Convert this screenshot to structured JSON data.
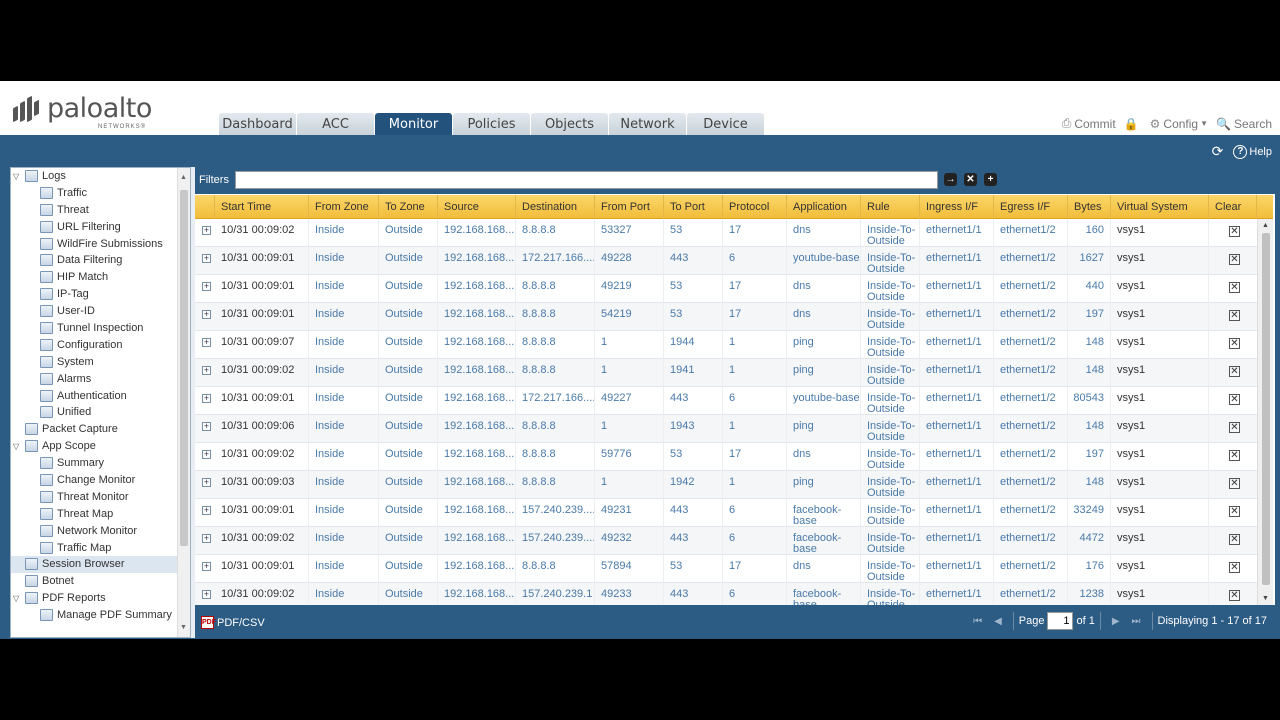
{
  "brand": {
    "name": "paloalto",
    "sub": "NETWORKS®"
  },
  "tabs": [
    "Dashboard",
    "ACC",
    "Monitor",
    "Policies",
    "Objects",
    "Network",
    "Device"
  ],
  "active_tab": "Monitor",
  "top_actions": {
    "commit": "Commit",
    "config": "Config",
    "search": "Search"
  },
  "help_label": "Help",
  "sidebar": [
    {
      "label": "Logs",
      "level": 0,
      "toggle": "▽"
    },
    {
      "label": "Traffic",
      "level": 1
    },
    {
      "label": "Threat",
      "level": 1
    },
    {
      "label": "URL Filtering",
      "level": 1
    },
    {
      "label": "WildFire Submissions",
      "level": 1
    },
    {
      "label": "Data Filtering",
      "level": 1
    },
    {
      "label": "HIP Match",
      "level": 1
    },
    {
      "label": "IP-Tag",
      "level": 1
    },
    {
      "label": "User-ID",
      "level": 1
    },
    {
      "label": "Tunnel Inspection",
      "level": 1
    },
    {
      "label": "Configuration",
      "level": 1
    },
    {
      "label": "System",
      "level": 1
    },
    {
      "label": "Alarms",
      "level": 1
    },
    {
      "label": "Authentication",
      "level": 1
    },
    {
      "label": "Unified",
      "level": 1
    },
    {
      "label": "Packet Capture",
      "level": 0
    },
    {
      "label": "App Scope",
      "level": 0,
      "toggle": "▽"
    },
    {
      "label": "Summary",
      "level": 1
    },
    {
      "label": "Change Monitor",
      "level": 1
    },
    {
      "label": "Threat Monitor",
      "level": 1
    },
    {
      "label": "Threat Map",
      "level": 1
    },
    {
      "label": "Network Monitor",
      "level": 1
    },
    {
      "label": "Traffic Map",
      "level": 1
    },
    {
      "label": "Session Browser",
      "level": 0,
      "selected": true
    },
    {
      "label": "Botnet",
      "level": 0
    },
    {
      "label": "PDF Reports",
      "level": 0,
      "toggle": "▽"
    },
    {
      "label": "Manage PDF Summary",
      "level": 1
    }
  ],
  "filters": {
    "label": "Filters",
    "value": "",
    "placeholder": ""
  },
  "columns": [
    "Start Time",
    "From Zone",
    "To Zone",
    "Source",
    "Destination",
    "From Port",
    "To Port",
    "Protocol",
    "Application",
    "Rule",
    "Ingress I/F",
    "Egress I/F",
    "Bytes",
    "Virtual System",
    "Clear"
  ],
  "rows": [
    [
      "10/31 00:09:02",
      "Inside",
      "Outside",
      "192.168.168....",
      "8.8.8.8",
      "53327",
      "53",
      "17",
      "dns",
      "Inside-To-Outside",
      "ethernet1/1",
      "ethernet1/2",
      "160",
      "vsys1"
    ],
    [
      "10/31 00:09:01",
      "Inside",
      "Outside",
      "192.168.168....",
      "172.217.166....",
      "49228",
      "443",
      "6",
      "youtube-base",
      "Inside-To-Outside",
      "ethernet1/1",
      "ethernet1/2",
      "1627",
      "vsys1"
    ],
    [
      "10/31 00:09:01",
      "Inside",
      "Outside",
      "192.168.168....",
      "8.8.8.8",
      "49219",
      "53",
      "17",
      "dns",
      "Inside-To-Outside",
      "ethernet1/1",
      "ethernet1/2",
      "440",
      "vsys1"
    ],
    [
      "10/31 00:09:01",
      "Inside",
      "Outside",
      "192.168.168....",
      "8.8.8.8",
      "54219",
      "53",
      "17",
      "dns",
      "Inside-To-Outside",
      "ethernet1/1",
      "ethernet1/2",
      "197",
      "vsys1"
    ],
    [
      "10/31 00:09:07",
      "Inside",
      "Outside",
      "192.168.168....",
      "8.8.8.8",
      "1",
      "1944",
      "1",
      "ping",
      "Inside-To-Outside",
      "ethernet1/1",
      "ethernet1/2",
      "148",
      "vsys1"
    ],
    [
      "10/31 00:09:02",
      "Inside",
      "Outside",
      "192.168.168....",
      "8.8.8.8",
      "1",
      "1941",
      "1",
      "ping",
      "Inside-To-Outside",
      "ethernet1/1",
      "ethernet1/2",
      "148",
      "vsys1"
    ],
    [
      "10/31 00:09:01",
      "Inside",
      "Outside",
      "192.168.168....",
      "172.217.166....",
      "49227",
      "443",
      "6",
      "youtube-base",
      "Inside-To-Outside",
      "ethernet1/1",
      "ethernet1/2",
      "80543",
      "vsys1"
    ],
    [
      "10/31 00:09:06",
      "Inside",
      "Outside",
      "192.168.168....",
      "8.8.8.8",
      "1",
      "1943",
      "1",
      "ping",
      "Inside-To-Outside",
      "ethernet1/1",
      "ethernet1/2",
      "148",
      "vsys1"
    ],
    [
      "10/31 00:09:02",
      "Inside",
      "Outside",
      "192.168.168....",
      "8.8.8.8",
      "59776",
      "53",
      "17",
      "dns",
      "Inside-To-Outside",
      "ethernet1/1",
      "ethernet1/2",
      "197",
      "vsys1"
    ],
    [
      "10/31 00:09:03",
      "Inside",
      "Outside",
      "192.168.168....",
      "8.8.8.8",
      "1",
      "1942",
      "1",
      "ping",
      "Inside-To-Outside",
      "ethernet1/1",
      "ethernet1/2",
      "148",
      "vsys1"
    ],
    [
      "10/31 00:09:01",
      "Inside",
      "Outside",
      "192.168.168....",
      "157.240.239....",
      "49231",
      "443",
      "6",
      "facebook-base",
      "Inside-To-Outside",
      "ethernet1/1",
      "ethernet1/2",
      "33249",
      "vsys1"
    ],
    [
      "10/31 00:09:02",
      "Inside",
      "Outside",
      "192.168.168....",
      "157.240.239....",
      "49232",
      "443",
      "6",
      "facebook-base",
      "Inside-To-Outside",
      "ethernet1/1",
      "ethernet1/2",
      "4472",
      "vsys1"
    ],
    [
      "10/31 00:09:01",
      "Inside",
      "Outside",
      "192.168.168....",
      "8.8.8.8",
      "57894",
      "53",
      "17",
      "dns",
      "Inside-To-Outside",
      "ethernet1/1",
      "ethernet1/2",
      "176",
      "vsys1"
    ],
    [
      "10/31 00:09:02",
      "Inside",
      "Outside",
      "192.168.168....",
      "157.240.239.1",
      "49233",
      "443",
      "6",
      "facebook-base",
      "Inside-To-Outside",
      "ethernet1/1",
      "ethernet1/2",
      "1238",
      "vsys1"
    ]
  ],
  "footer": {
    "export": "PDF/CSV",
    "page_label": "Page",
    "page_value": "1",
    "of_label": "of 1",
    "displaying": "Displaying 1 - 17 of 17"
  },
  "colors": {
    "accent": "#2c5b84",
    "header_gold": "#f2bd3a",
    "link": "#4a7aa8"
  }
}
